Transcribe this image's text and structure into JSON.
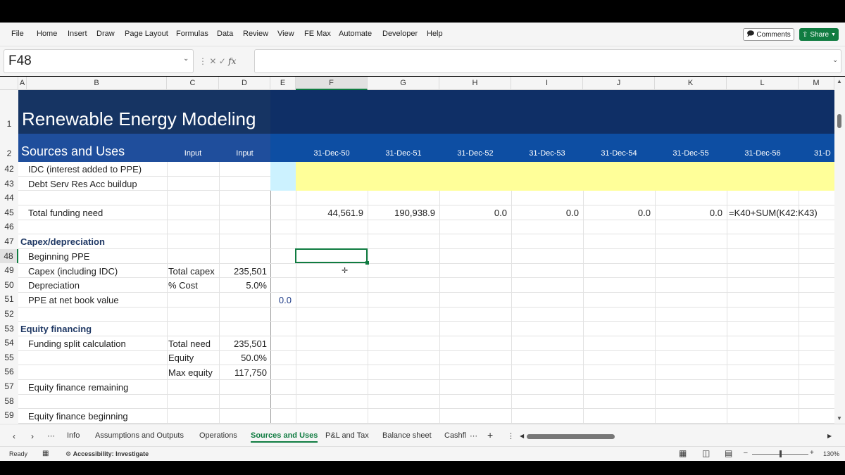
{
  "menu_tabs": [
    "File",
    "Home",
    "Insert",
    "Draw",
    "Page Layout",
    "Formulas",
    "Data",
    "Review",
    "View",
    "FE Max",
    "Automate",
    "Developer",
    "Help"
  ],
  "ribbon_buttons": {
    "comments": "Comments",
    "share": "Share"
  },
  "namebox": {
    "value": "F48"
  },
  "formula_bar": {
    "fx": "fx",
    "value": ""
  },
  "columns": [
    "A",
    "B",
    "C",
    "D",
    "E",
    "F",
    "G",
    "H",
    "I",
    "J",
    "K",
    "L",
    "M"
  ],
  "row_numbers": [
    "1",
    "2",
    "42",
    "43",
    "44",
    "45",
    "46",
    "47",
    "48",
    "49",
    "50",
    "51",
    "52",
    "53",
    "54",
    "55",
    "56",
    "57",
    "58",
    "59"
  ],
  "header": {
    "title": "Renewable Energy Modeling",
    "subtitle": "Sources and Uses",
    "input_c": "Input",
    "input_d": "Input",
    "dates": [
      "31-Dec-50",
      "31-Dec-51",
      "31-Dec-52",
      "31-Dec-53",
      "31-Dec-54",
      "31-Dec-55",
      "31-Dec-56",
      "31-D"
    ]
  },
  "rows": {
    "r42": {
      "b": "IDC (interest added to PPE)"
    },
    "r43": {
      "b": "Debt Serv Res Acc buildup"
    },
    "r45": {
      "b": "Total funding need",
      "f": "44,561.9",
      "g": "190,938.9",
      "h": "0.0",
      "i": "0.0",
      "j": "0.0",
      "k": "0.0",
      "l": "=K40+SUM(K42:K43)"
    },
    "r47": {
      "a": "Capex/depreciation"
    },
    "r48": {
      "b": "Beginning PPE"
    },
    "r49": {
      "b": "Capex (including IDC)",
      "c": "Total capex",
      "d": "235,501"
    },
    "r50": {
      "b": "Depreciation",
      "c": "% Cost",
      "d": "5.0%"
    },
    "r51": {
      "b": "PPE at net book value",
      "e": "0.0"
    },
    "r53": {
      "a": "Equity financing"
    },
    "r54": {
      "b": "Funding split calculation",
      "c": "Total need",
      "d": "235,501"
    },
    "r55": {
      "c": "Equity",
      "d": "50.0%"
    },
    "r56": {
      "c": "Max equity",
      "d": "117,750"
    },
    "r57": {
      "b": "Equity finance remaining"
    },
    "r59": {
      "b": "Equity finance beginning"
    }
  },
  "sheet_tabs": [
    "Info",
    "Assumptions and Outputs",
    "Operations",
    "Sources and Uses",
    "P&L and Tax",
    "Balance sheet",
    "Cashfl"
  ],
  "active_sheet": "Sources and Uses",
  "status": {
    "ready": "Ready",
    "accessibility": "Accessibility: Investigate",
    "zoom": "130%"
  },
  "colors": {
    "banner_dark": "#163463",
    "banner_blue": "#1f4e9c",
    "highlight_yellow": "#ffff99",
    "highlight_cyan": "#ccf2ff",
    "excel_green": "#107c41"
  }
}
